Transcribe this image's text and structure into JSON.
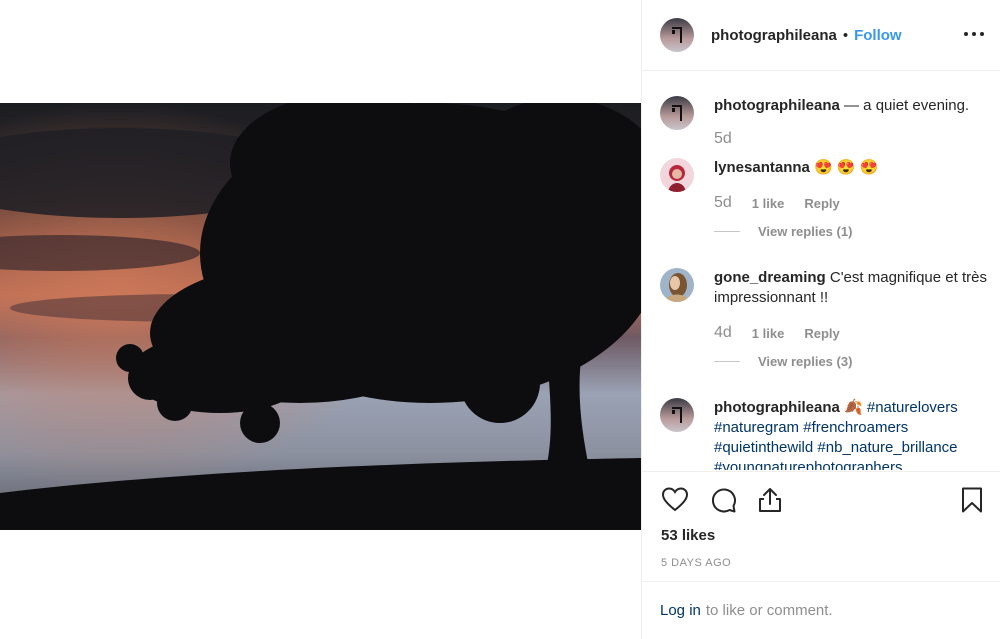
{
  "header": {
    "username": "photographileana",
    "separator": "•",
    "follow_label": "Follow"
  },
  "comments": [
    {
      "username": "photographileana",
      "text": " — a quiet evening.",
      "time": "5d"
    },
    {
      "username": "lynesantanna",
      "text": " 😍 😍 😍",
      "time": "5d",
      "likes": "1 like",
      "reply_label": "Reply",
      "view_replies": "View replies (1)"
    },
    {
      "username": "gone_dreaming",
      "text": " C'est magnifique et très impressionnant !!",
      "time": "4d",
      "likes": "1 like",
      "reply_label": "Reply",
      "view_replies": "View replies (3)"
    },
    {
      "username": "photographileana",
      "emoji": " 🍂 ",
      "hashtags": [
        "#naturelovers",
        "#naturegram",
        "#frenchroamers",
        "#quietinthewild",
        "#nb_nature_brillance",
        "#youngnaturephotographers"
      ]
    }
  ],
  "actions": {
    "likes_count": "53 likes",
    "time_ago": "5 DAYS AGO"
  },
  "login": {
    "link_label": "Log in",
    "suffix": "to like or comment."
  },
  "icons": {
    "like": "heart-icon",
    "comment": "comment-bubble-icon",
    "share": "share-icon",
    "save": "bookmark-icon",
    "more": "more-horizontal-icon"
  },
  "colors": {
    "accent": "#3897f0",
    "hashtag": "#003569",
    "muted": "#8e8e8e",
    "text": "#262626"
  }
}
